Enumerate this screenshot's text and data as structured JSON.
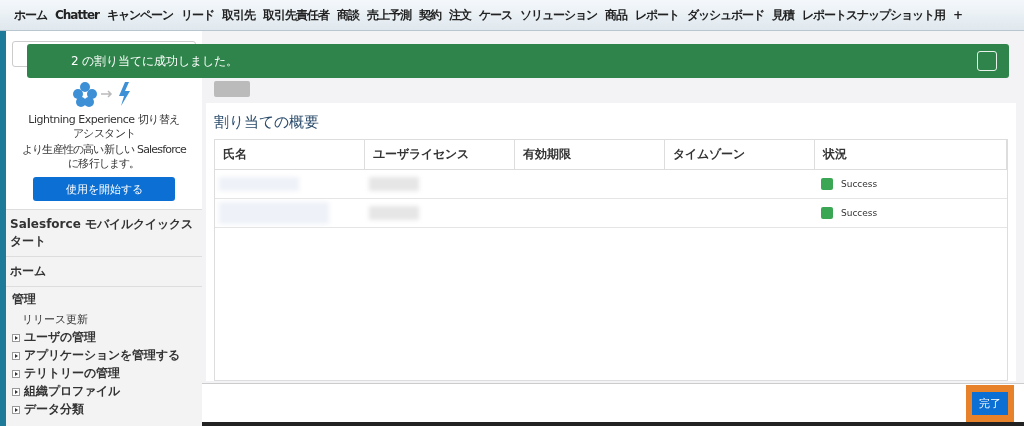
{
  "nav_tabs": [
    {
      "label": "ホーム"
    },
    {
      "label": "Chatter"
    },
    {
      "label": "キャンペーン"
    },
    {
      "label": "リード"
    },
    {
      "label": "取引先"
    },
    {
      "label": "取引先責任者"
    },
    {
      "label": "商談"
    },
    {
      "label": "売上予測"
    },
    {
      "label": "契約"
    },
    {
      "label": "注文"
    },
    {
      "label": "ケース"
    },
    {
      "label": "ソリューション"
    },
    {
      "label": "商品"
    },
    {
      "label": "レポート"
    },
    {
      "label": "ダッシュボード"
    },
    {
      "label": "見積"
    },
    {
      "label": "レポートスナップショット用"
    },
    {
      "label": "+"
    }
  ],
  "toast": {
    "message": "2 の割り当てに成功しました。"
  },
  "sidebar": {
    "promo": {
      "title": "Lightning Experience 切り替えアシスタント",
      "text": "より生産性の高い新しい Salesforce に移行します。",
      "button": "使用を開始する"
    },
    "sections": [
      {
        "label": "Salesforce モバイルクイックスタート"
      },
      {
        "label": "ホーム"
      }
    ],
    "admin": {
      "title": "管理",
      "link": "リリース更新",
      "items": [
        {
          "label": "ユーザの管理"
        },
        {
          "label": "アプリケーションを管理する"
        },
        {
          "label": "テリトリーの管理"
        },
        {
          "label": "組織プロファイル"
        },
        {
          "label": "データ分類"
        }
      ]
    }
  },
  "summary": {
    "title": "割り当ての概要",
    "columns": [
      "氏名",
      "ユーザライセンス",
      "有効期限",
      "タイムゾーン",
      "状況"
    ],
    "rows": [
      {
        "status": "Success",
        "color": "#3ba755"
      },
      {
        "status": "Success",
        "color": "#3ba755"
      }
    ]
  },
  "done_button": "完了"
}
